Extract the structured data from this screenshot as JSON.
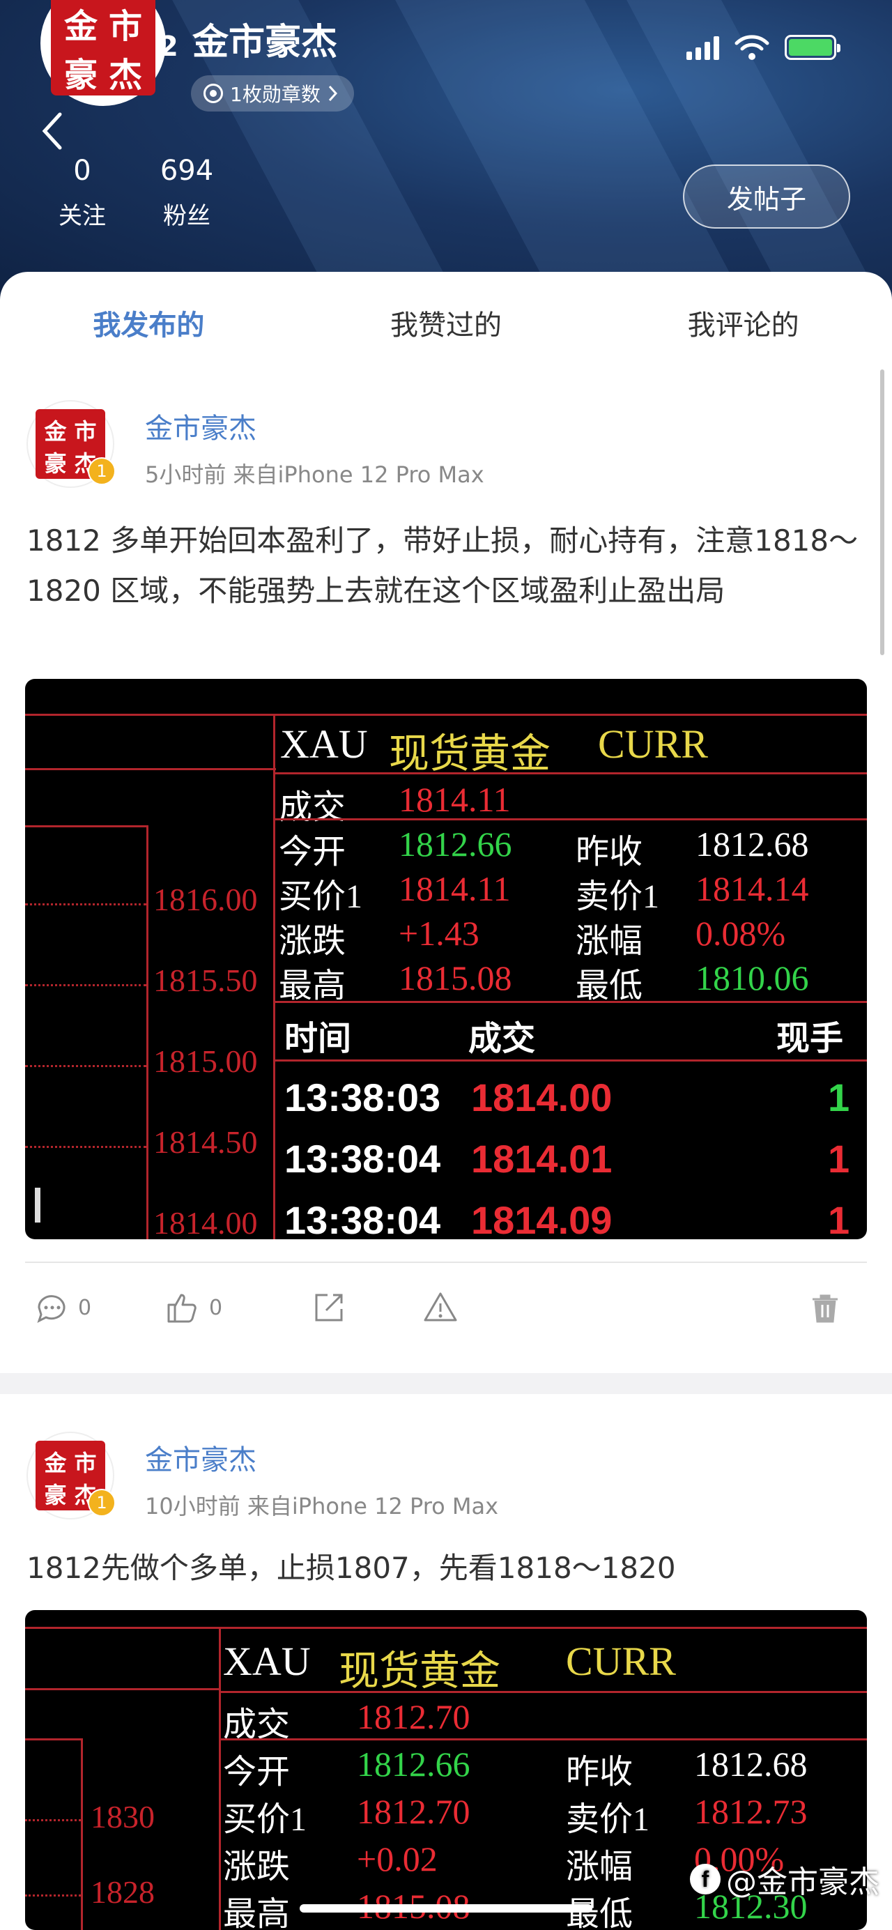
{
  "header": {
    "avatar_text": [
      "金",
      "市",
      "豪",
      "杰"
    ],
    "avatar_extra": "2",
    "username": "金市豪杰",
    "badge_label": "1枚勋章数",
    "stats": [
      {
        "value": "0",
        "label": "关注"
      },
      {
        "value": "694",
        "label": "粉丝"
      }
    ],
    "post_button": "发帖子"
  },
  "status_bar": {
    "battery": "charging",
    "icons": [
      "signal-icon",
      "wifi-icon",
      "battery-icon"
    ]
  },
  "tabs": [
    {
      "label": "我发布的",
      "active": true
    },
    {
      "label": "我赞过的",
      "active": false
    },
    {
      "label": "我评论的",
      "active": false
    }
  ],
  "posts": [
    {
      "author": "金市豪杰",
      "level": "1",
      "meta": "5小时前  来自iPhone 12 Pro Max",
      "text": "1812 多单开始回本盈利了，带好止损，耐心持有，注意1818～1820 区域，不能强势上去就在这个区域盈利止盈出局",
      "quote": {
        "symbol": "XAU",
        "name": "现货黄金",
        "currency": "CURR",
        "rows": {
          "deal_label": "成交",
          "deal": "1814.11",
          "open_label": "今开",
          "open": "1812.66",
          "prev_label": "昨收",
          "prev": "1812.68",
          "bid_label": "买价1",
          "bid": "1814.11",
          "ask_label": "卖价1",
          "ask": "1814.14",
          "chg_label": "涨跌",
          "chg": "+1.43",
          "pct_label": "涨幅",
          "pct": "0.08%",
          "high_label": "最高",
          "high": "1815.08",
          "low_label": "最低",
          "low": "1810.06"
        },
        "axis": [
          "1816.00",
          "1815.50",
          "1815.00",
          "1814.50",
          "1814.00"
        ],
        "ticks_header": {
          "time": "时间",
          "price": "成交",
          "vol": "现手"
        },
        "ticks": [
          {
            "time": "13:38:03",
            "price": "1814.00",
            "vol": "1"
          },
          {
            "time": "13:38:04",
            "price": "1814.01",
            "vol": "1"
          },
          {
            "time": "13:38:04",
            "price": "1814.09",
            "vol": "1"
          }
        ]
      },
      "actions": {
        "comments": "0",
        "likes": "0"
      }
    },
    {
      "author": "金市豪杰",
      "level": "1",
      "meta": "10小时前  来自iPhone 12 Pro Max",
      "text": "1812先做个多单，止损1807，先看1818～1820",
      "quote": {
        "symbol": "XAU",
        "name": "现货黄金",
        "currency": "CURR",
        "rows": {
          "deal_label": "成交",
          "deal": "1812.70",
          "open_label": "今开",
          "open": "1812.66",
          "prev_label": "昨收",
          "prev": "1812.68",
          "bid_label": "买价1",
          "bid": "1812.70",
          "ask_label": "卖价1",
          "ask": "1812.73",
          "chg_label": "涨跌",
          "chg": "+0.02",
          "pct_label": "涨幅",
          "pct": "0.00%",
          "high_label": "最高",
          "high": "1815.08",
          "low_label": "最低",
          "low": "1812.30"
        },
        "axis": [
          "1830",
          "1828"
        ]
      }
    }
  ],
  "watermark": "@金市豪杰"
}
